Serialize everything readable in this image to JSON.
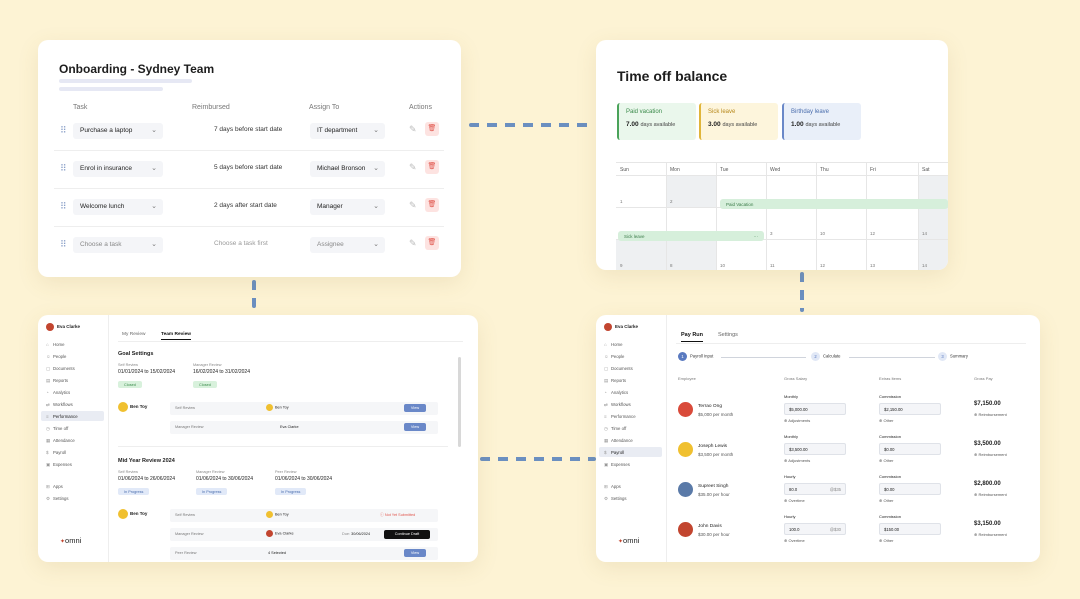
{
  "colors": {
    "background": "#fdf3d4",
    "accent": "#6b8fc0",
    "danger": "#e0554c",
    "vacation": "#3a8a4a",
    "sick": "#b8891c",
    "birthday": "#4a6dad"
  },
  "onboarding": {
    "title": "Onboarding - Sydney Team",
    "headers": {
      "task": "Task",
      "reimbursed": "Reimbursed",
      "assign": "Assign To",
      "actions": "Actions"
    },
    "rows": [
      {
        "task": "Purchase a laptop",
        "reimbursed": "7 days before start date",
        "assignee": "IT department"
      },
      {
        "task": "Enrol in insurance",
        "reimbursed": "5 days before start date",
        "assignee": "Michael Bronson"
      },
      {
        "task": "Welcome lunch",
        "reimbursed": "2 days after start date",
        "assignee": "Manager"
      },
      {
        "task": "Choose a task",
        "reimbursed": "Choose a task first",
        "assignee": "Assignee"
      }
    ]
  },
  "timeoff": {
    "title": "Time off balance",
    "balances": [
      {
        "type": "Paid vacation",
        "value": "7.00",
        "unit": "days available"
      },
      {
        "type": "Sick leave",
        "value": "3.00",
        "unit": "days available"
      },
      {
        "type": "Birthday leave",
        "value": "1.00",
        "unit": "days available"
      }
    ],
    "days": [
      "Sun",
      "Mon",
      "Tue",
      "Wed",
      "Thu",
      "Fri",
      "Sat"
    ],
    "week1": [
      "1",
      "2"
    ],
    "week2": [
      "3",
      "10",
      "12",
      "14"
    ],
    "week3": [
      "9",
      "8",
      "10",
      "11",
      "12",
      "13",
      "14"
    ],
    "events": {
      "vacation": "Paid Vacation",
      "sick": "Sick leave",
      "sick_more": "···"
    }
  },
  "performance": {
    "user": "Eva Clarke",
    "nav": [
      "Home",
      "People",
      "Documents",
      "Reports",
      "Analytics",
      "Workflows",
      "Performance",
      "Time off",
      "Attendance",
      "Payroll",
      "Expenses",
      "Apps",
      "Settings"
    ],
    "logo": "omni",
    "tabs": [
      "My Review",
      "Team Review"
    ],
    "goal": {
      "title": "Goal Settings",
      "self_label": "Self Review",
      "self_dates": "01/01/2024 to 15/02/2024",
      "self_status": "Closed",
      "mgr_label": "Manager Review",
      "mgr_dates": "16/02/2024 to 31/02/2024",
      "mgr_status": "Closed",
      "person": "Ben Toy",
      "rows": [
        {
          "label": "Self Review",
          "name": "Ben Toy",
          "action": "View"
        },
        {
          "label": "Manager Review",
          "name": "Eva Clarke",
          "action": "View"
        }
      ]
    },
    "midyear": {
      "title": "Mid Year Review 2024",
      "self_label": "Self Review",
      "self_dates": "01/06/2024 to 26/06/2024",
      "self_status": "In Progress",
      "mgr_label": "Manager Review",
      "mgr_dates": "01/06/2024 to 30/06/2024",
      "mgr_status": "In Progress",
      "peer_label": "Peer Review",
      "peer_dates": "01/06/2024 to 30/06/2024",
      "peer_status": "In Progress",
      "person": "Ben Toy",
      "rows": [
        {
          "label": "Self Review",
          "name": "Ben Toy",
          "status": "Not Yet Submitted"
        },
        {
          "label": "Manager Review",
          "name": "Eva Clarke",
          "due_label": "Due:",
          "due": "30/06/2024",
          "action": "Continue Draft"
        },
        {
          "label": "Peer Review",
          "name": "4 Selected",
          "action": "View"
        }
      ]
    }
  },
  "payroll": {
    "user": "Eva Clarke",
    "nav": [
      "Home",
      "People",
      "Documents",
      "Reports",
      "Analytics",
      "Workflows",
      "Performance",
      "Time off",
      "Attendance",
      "Payroll",
      "Expenses",
      "Apps",
      "Settings"
    ],
    "logo": "omni",
    "tabs": [
      "Pay Run",
      "Settings"
    ],
    "steps": [
      {
        "n": "1",
        "label": "Payroll Input"
      },
      {
        "n": "2",
        "label": "Calculate"
      },
      {
        "n": "3",
        "label": "Summary"
      }
    ],
    "columns": [
      "Employee",
      "Gross Salary",
      "Extras Items",
      "Gross Pay"
    ],
    "employees": [
      {
        "name": "Terrao Ong",
        "rate": "$5,000 per month",
        "field": "Monthly",
        "value": "$5,000.00",
        "suffix": "",
        "sub": "Adjustments",
        "extra_label": "Commission",
        "extra": "$2,150.00",
        "extra_sub": "Other",
        "gross": "$7,150.00",
        "gross_sub": "Reimbursement"
      },
      {
        "name": "Joseph Lewis",
        "rate": "$3,500 per month",
        "field": "Monthly",
        "value": "$3,500.00",
        "suffix": "",
        "sub": "Adjustments",
        "extra_label": "Commission",
        "extra": "$0.00",
        "extra_sub": "Other",
        "gross": "$3,500.00",
        "gross_sub": "Reimbursement"
      },
      {
        "name": "Supreet Singh",
        "rate": "$35.00 per hour",
        "field": "Hourly",
        "value": "80.0",
        "suffix": "@$35",
        "sub": "Overtime",
        "extra_label": "Commission",
        "extra": "$0.00",
        "extra_sub": "Other",
        "gross": "$2,800.00",
        "gross_sub": "Reimbursement"
      },
      {
        "name": "John Davis",
        "rate": "$30.00 per hour",
        "field": "Hourly",
        "value": "100.0",
        "suffix": "@$30",
        "sub": "Overtime",
        "extra_label": "Commission",
        "extra": "$150.00",
        "extra_sub": "Other",
        "gross": "$3,150.00",
        "gross_sub": "Reimbursement"
      }
    ]
  }
}
